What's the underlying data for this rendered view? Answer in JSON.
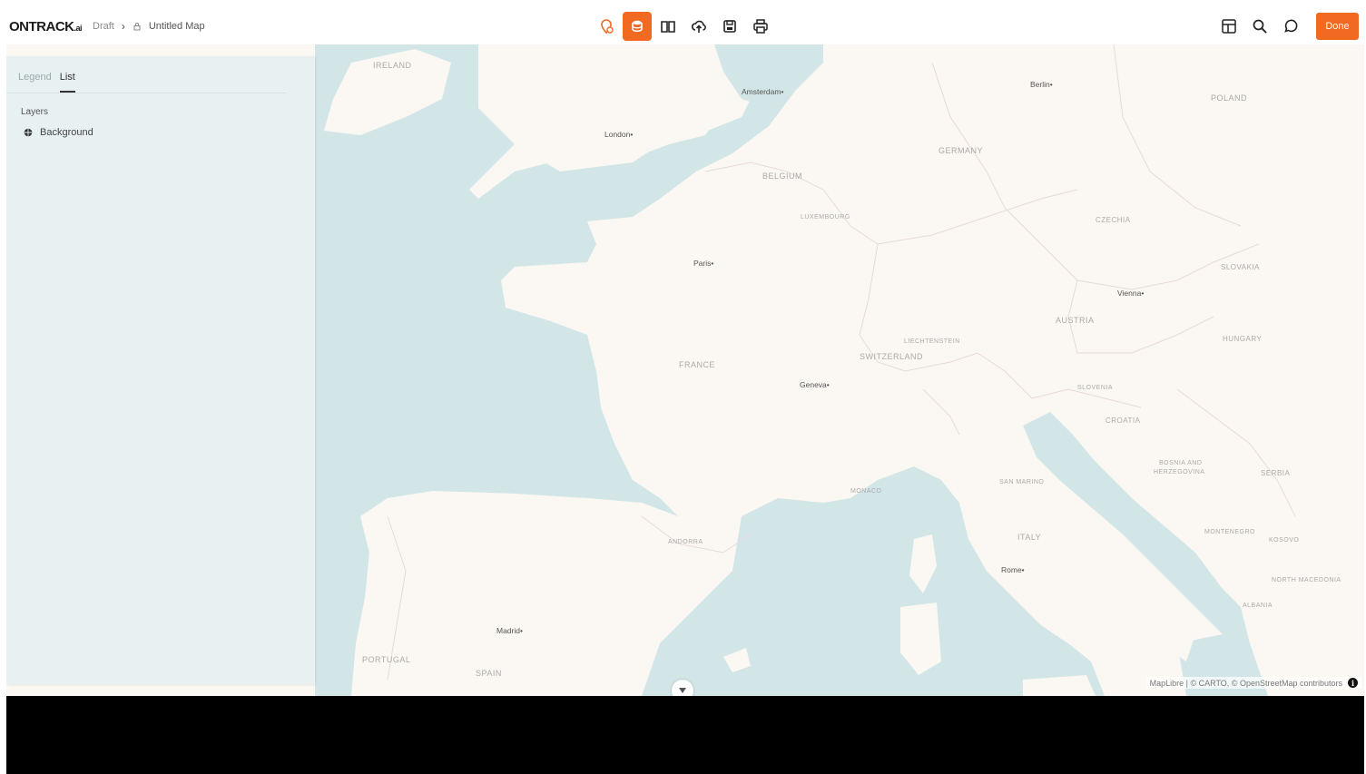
{
  "header": {
    "logo_main": "ONTRACK",
    "logo_suffix": ".ai",
    "breadcrumb_draft": "Draft",
    "breadcrumb_title": "Untitled Map",
    "done_label": "Done"
  },
  "toolbar_icons": [
    "map-pin-icon",
    "layers-icon",
    "book-icon",
    "upload-cloud-icon",
    "save-icon",
    "print-icon"
  ],
  "right_icons": [
    "table-icon",
    "search-icon",
    "comment-icon"
  ],
  "panel": {
    "tabs": [
      {
        "label": "Legend",
        "active": false
      },
      {
        "label": "List",
        "active": true
      }
    ],
    "section_label": "Layers",
    "layers": [
      {
        "label": "Background"
      }
    ]
  },
  "map": {
    "countries": [
      "IRELAND",
      "POLAND",
      "GERMANY",
      "BELGIUM",
      "LUXEMBOURG",
      "CZECHIA",
      "SLOVAKIA",
      "AUSTRIA",
      "HUNGARY",
      "LIECHTENSTEIN",
      "SWITZERLAND",
      "FRANCE",
      "SLOVENIA",
      "CROATIA",
      "BOSNIA AND",
      "HERZEGOVINA",
      "SERBIA",
      "SAN MARINO",
      "MONACO",
      "ITALY",
      "MONTENEGRO",
      "KOSOVO",
      "NORTH MACEDONIA",
      "ALBANIA",
      "ANDORRA",
      "PORTUGAL",
      "SPAIN"
    ],
    "cities": [
      "Amsterdam",
      "Berlin",
      "London",
      "Paris",
      "Vienna",
      "Geneva",
      "Rome",
      "Madrid"
    ],
    "attribution": "MapLibre | © CARTO, © OpenStreetMap contributors"
  },
  "colors": {
    "accent": "#f26a21",
    "water": "#d3e6e7",
    "land": "#fbf8f3",
    "panel": "#e7f1f1"
  }
}
